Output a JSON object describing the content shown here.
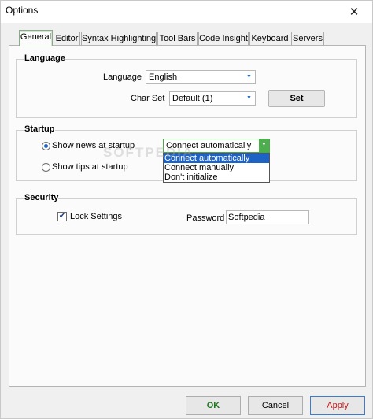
{
  "window": {
    "title": "Options",
    "close_glyph": "✕"
  },
  "tabs": [
    {
      "label": "General",
      "active": true
    },
    {
      "label": "Editor",
      "active": false
    },
    {
      "label": "Syntax Highlighting",
      "active": false
    },
    {
      "label": "Tool Bars",
      "active": false
    },
    {
      "label": "Code Insight",
      "active": false
    },
    {
      "label": "Keyboard",
      "active": false
    },
    {
      "label": "Servers",
      "active": false
    }
  ],
  "language": {
    "group_label": "Language",
    "language_label": "Language",
    "language_value": "English",
    "charset_label": "Char Set",
    "charset_value": "Default (1)",
    "set_button": "Set"
  },
  "startup": {
    "group_label": "Startup",
    "show_news_label": "Show news at startup",
    "show_news_selected": true,
    "show_tips_label": "Show tips at startup",
    "show_tips_selected": false,
    "mode_value": "Connect automatically",
    "mode_options": [
      "Connect automatically",
      "Connect manually",
      "Don't initialize"
    ],
    "mode_selected_index": 0
  },
  "security": {
    "group_label": "Security",
    "lock_label": "Lock Settings",
    "lock_checked": true,
    "password_label": "Password",
    "password_value": "Softpedia"
  },
  "footer": {
    "ok": "OK",
    "cancel": "Cancel",
    "apply": "Apply"
  },
  "colors": {
    "ok_text": "#1e7a1e",
    "apply_text": "#c11a1a",
    "selection": "#1d63c6"
  },
  "icons": {
    "dropdown_arrow": "chevron-down-icon",
    "check_mark": "check-icon",
    "close": "close-icon"
  },
  "watermark": "SOFTPEDIA"
}
